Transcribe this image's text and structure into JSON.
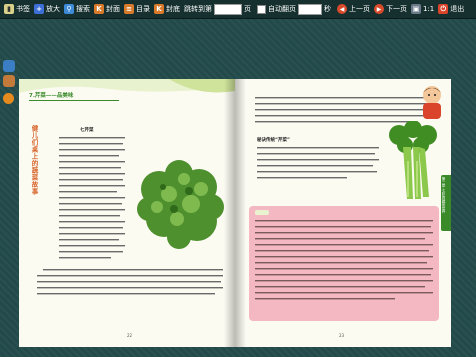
{
  "toolbar": {
    "bookmark": "书签",
    "zoom_in": "放大",
    "search": "搜索",
    "cover1": "封面",
    "toc": "目录",
    "cover2": "封底",
    "jump_prefix": "跳转到第",
    "jump_suffix": "页",
    "auto_flip": "自动翻页",
    "seconds": "秒",
    "prev": "上一页",
    "next": "下一页",
    "ratio": "1:1",
    "exit": "退出"
  },
  "left_page": {
    "chapter_title": "7.芹菜——品美味",
    "vertical_title": "健儿们桌上的蔬菜故事",
    "heading": "七芹菜",
    "page_number": "22"
  },
  "right_page": {
    "subheading": "秘诀传统“芹菜”",
    "side_tab": "第二章 七彩的蔬菜世界",
    "page_number": "23"
  },
  "colors": {
    "toolbar_bg": "#15302f",
    "desk_bg": "#234a4a",
    "page_bg": "#fbfbf2",
    "accent_green": "#3a8a2a",
    "title_orange": "#d8642a"
  }
}
